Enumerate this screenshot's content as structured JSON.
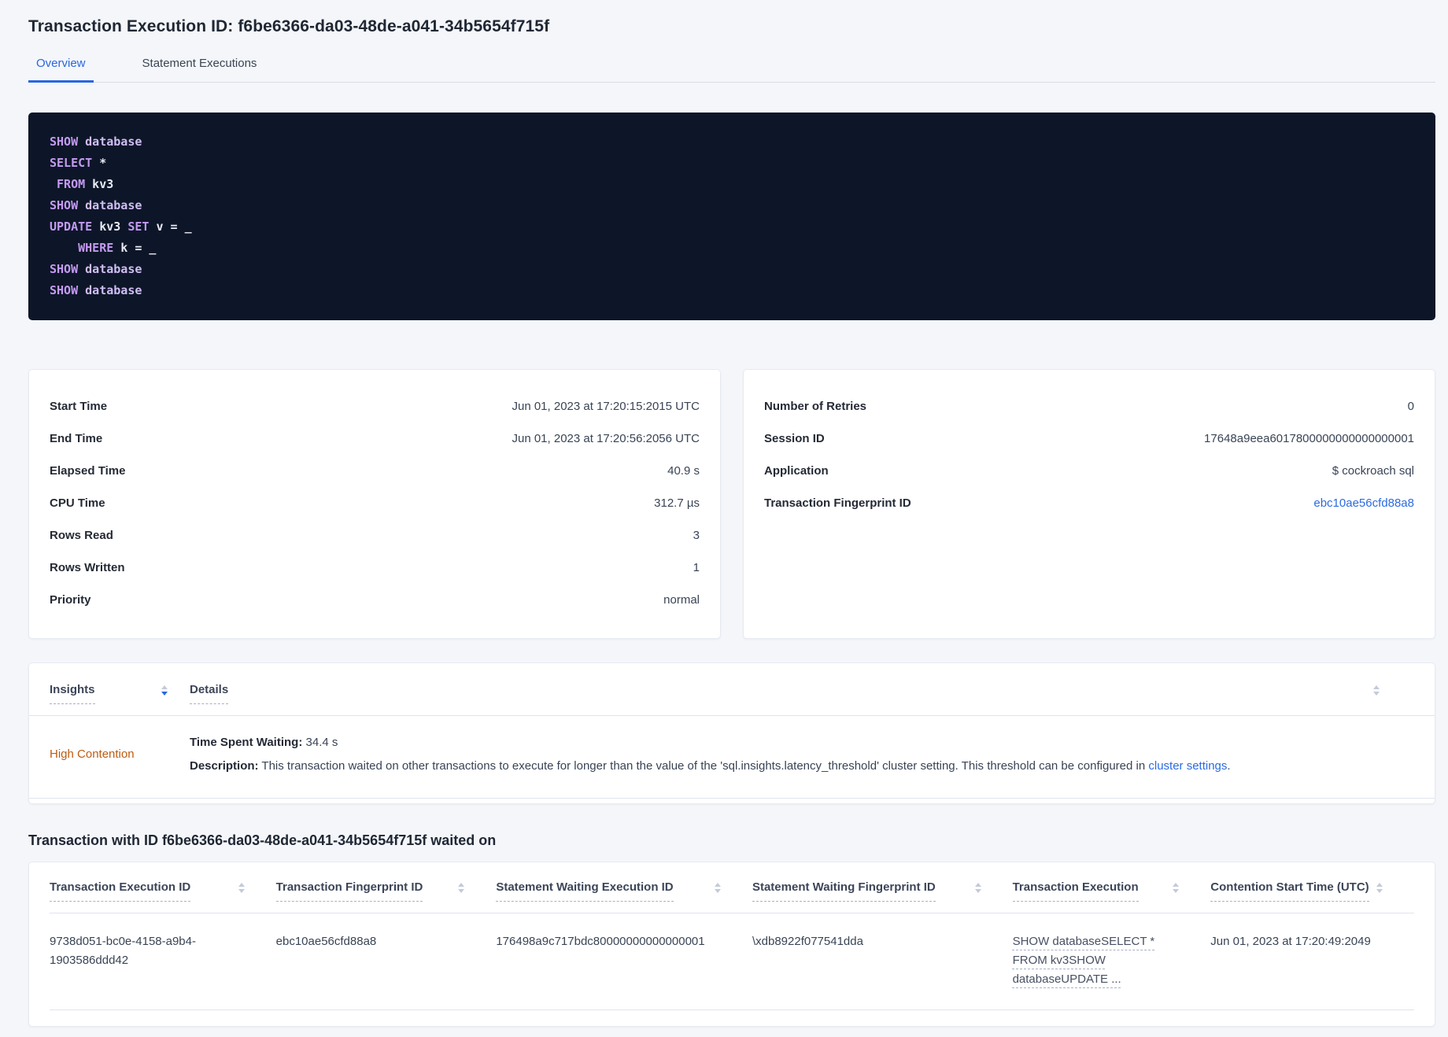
{
  "page_title": "Transaction Execution ID: f6be6366-da03-48de-a041-34b5654f715f",
  "tabs": {
    "overview": "Overview",
    "statement_executions": "Statement Executions"
  },
  "sql_lines": [
    [
      {
        "t": "SHOW"
      },
      {
        "t": " database"
      }
    ],
    [
      {
        "t": "SELECT"
      },
      {
        "t": " *"
      }
    ],
    [
      {
        "t": " FROM"
      },
      {
        "t": " kv3"
      }
    ],
    [
      {
        "t": "SHOW"
      },
      {
        "t": " database"
      }
    ],
    [
      {
        "t": "UPDATE"
      },
      {
        "t": " kv3 "
      },
      {
        "t": "SET"
      },
      {
        "t": " v = _"
      }
    ],
    [
      {
        "t": "    WHERE"
      },
      {
        "t": " k = _"
      }
    ],
    [
      {
        "t": "SHOW"
      },
      {
        "t": " database"
      }
    ],
    [
      {
        "t": "SHOW"
      },
      {
        "t": " database"
      }
    ]
  ],
  "details_card": {
    "rows": [
      {
        "label": "Start Time",
        "value": "Jun 01, 2023 at 17:20:15:2015 UTC"
      },
      {
        "label": "End Time",
        "value": "Jun 01, 2023 at 17:20:56:2056 UTC"
      },
      {
        "label": "Elapsed Time",
        "value": "40.9 s"
      },
      {
        "label": "CPU Time",
        "value": "312.7 µs"
      },
      {
        "label": "Rows Read",
        "value": "3"
      },
      {
        "label": "Rows Written",
        "value": "1"
      },
      {
        "label": "Priority",
        "value": "normal"
      }
    ]
  },
  "meta_card": {
    "rows": [
      {
        "label": "Number of Retries",
        "value": "0"
      },
      {
        "label": "Session ID",
        "value": "17648a9eea6017800000000000000001"
      },
      {
        "label": "Application",
        "value": "$ cockroach sql"
      },
      {
        "label": "Transaction Fingerprint ID",
        "value": "ebc10ae56cfd88a8"
      }
    ]
  },
  "insights_table": {
    "header_insights": "Insights",
    "header_details": "Details",
    "row": {
      "insight": "High Contention",
      "waiting_label": "Time Spent Waiting:",
      "waiting_value": " 34.4 s",
      "description_label": "Description:",
      "description_text": " This transaction waited on other transactions to execute for longer than the value of the 'sql.insights.latency_threshold' cluster setting. This threshold can be configured in ",
      "description_link": "cluster settings",
      "description_suffix": "."
    }
  },
  "waited_on": {
    "heading": "Transaction with ID f6be6366-da03-48de-a041-34b5654f715f waited on",
    "columns": [
      "Transaction Execution ID",
      "Transaction Fingerprint ID",
      "Statement Waiting Execution ID",
      "Statement Waiting Fingerprint ID",
      "Transaction Execution",
      "Contention Start Time (UTC)"
    ],
    "row": {
      "transaction_execution_id": "9738d051-bc0e-4158-a9b4-1903586ddd42",
      "transaction_fingerprint_id": "ebc10ae56cfd88a8",
      "statement_waiting_execution_id": "176498a9c717bdc80000000000000001",
      "statement_waiting_fingerprint_id": "\\xdb8922f077541dda",
      "transaction_execution": "SHOW databaseSELECT * FROM kv3SHOW databaseUPDATE ...",
      "contention_start_time": "Jun 01, 2023 at 17:20:49:2049"
    }
  },
  "colors": {
    "accent_blue": "#2a66df",
    "link_blue": "#2b6be2",
    "contention_orange": "#bf5b0f",
    "code_background": "#0d1628",
    "code_keyword": "#c49af2",
    "code_plain": "#e8eaf4",
    "page_background": "#f4f6fa"
  }
}
